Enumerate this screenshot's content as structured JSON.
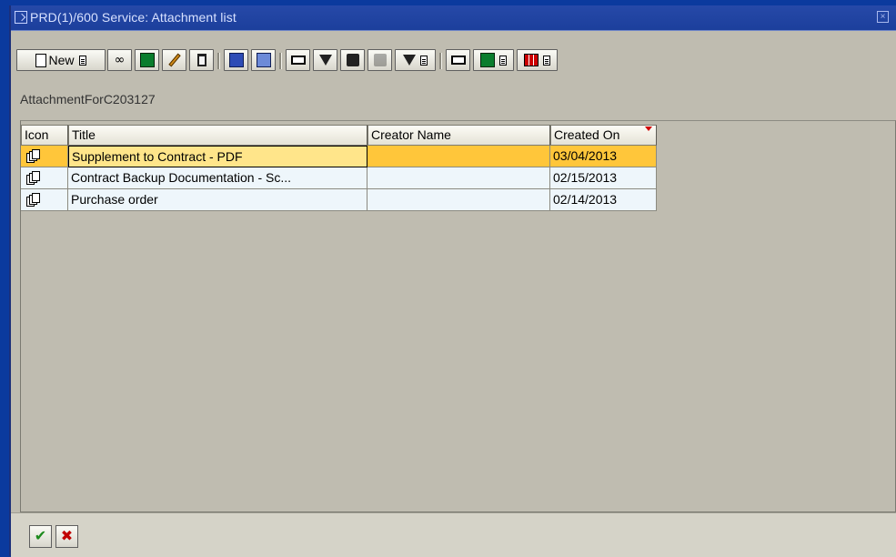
{
  "window": {
    "title": "PRD(1)/600 Service: Attachment list"
  },
  "toolbar": {
    "new_label": "New",
    "buttons": [
      "new-button",
      "view-button",
      "export-button",
      "edit-button",
      "delete-button",
      "refresh-button",
      "detail-button",
      "print-button",
      "filter-set-button",
      "find-button",
      "find-next-button",
      "filter-button",
      "print-preview-button",
      "export-local-button",
      "layout-button"
    ]
  },
  "breadcrumb": "AttachmentForC203127",
  "table": {
    "columns": [
      "Icon",
      "Title",
      "Creator Name",
      "Created On"
    ],
    "sorted_column": "Created On",
    "rows": [
      {
        "icon": "documents-icon",
        "title": "Supplement to Contract - PDF",
        "creator": "",
        "created_on": "03/04/2013",
        "selected": true
      },
      {
        "icon": "documents-icon",
        "title": "Contract Backup Documentation - Sc...",
        "creator": "",
        "created_on": "02/15/2013",
        "selected": false
      },
      {
        "icon": "documents-icon",
        "title": "Purchase order",
        "creator": "",
        "created_on": "02/14/2013",
        "selected": false
      }
    ]
  },
  "footer": {
    "ok": "✔",
    "cancel": "✖"
  },
  "colors": {
    "selected_row": "#ffc63a",
    "row_background": "#eef6fb",
    "titlebar": "#1c3f9c",
    "panel": "#bfbcb0"
  }
}
